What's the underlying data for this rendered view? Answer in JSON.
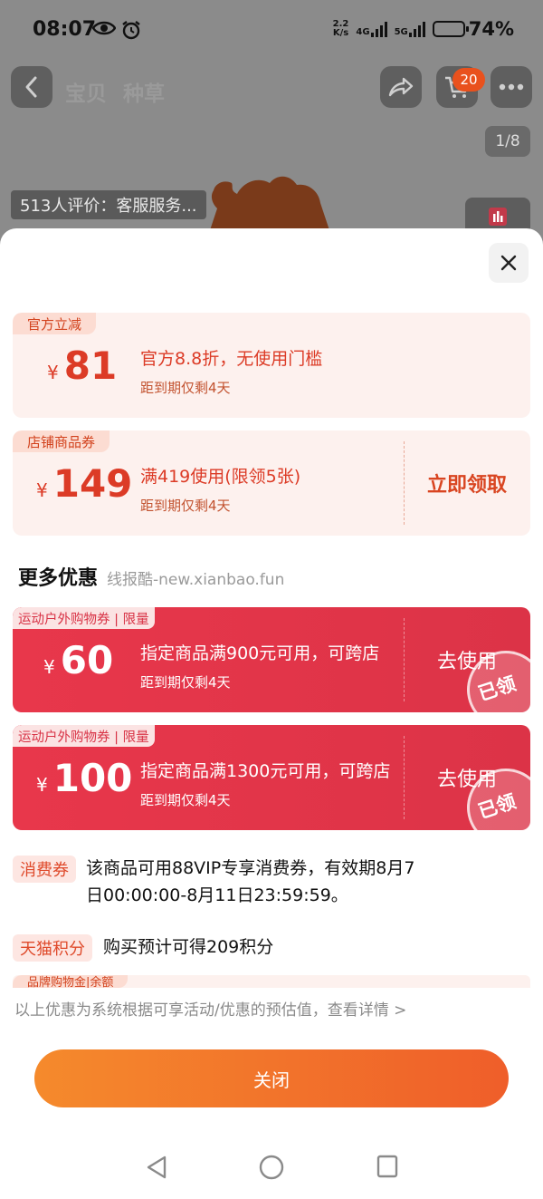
{
  "status_bar": {
    "time": "08:07",
    "net_speed_value": "2.2",
    "net_speed_unit": "K/s",
    "sim1": "4G",
    "sim2": "5G",
    "battery": "74%",
    "battery_level": 0.74
  },
  "product_page": {
    "nav_tabs": [
      "宝贝",
      "种草"
    ],
    "cart_count": "20",
    "image_index": "1/8",
    "review_snippet": "513人评价：客服服务..."
  },
  "coupons_top": [
    {
      "tag": "官方立减",
      "currency": "¥",
      "amount": "81",
      "description": "官方8.8折，无使用门槛",
      "expiry": "距到期仅剩4天",
      "action": ""
    },
    {
      "tag": "店铺商品券",
      "currency": "¥",
      "amount": "149",
      "description": "满419使用(限领5张)",
      "expiry": "距到期仅剩4天",
      "action": "立即领取"
    }
  ],
  "more_section": {
    "title": "更多优惠",
    "watermark": "线报酷-new.xianbao.fun"
  },
  "coupons_more": [
    {
      "tag": "运动户外购物券 | 限量",
      "currency": "¥",
      "amount": "60",
      "description": "指定商品满900元可用，可跨店",
      "expiry": "距到期仅剩4天",
      "action": "去使用",
      "stamp": "已领"
    },
    {
      "tag": "运动户外购物券 | 限量",
      "currency": "¥",
      "amount": "100",
      "description": "指定商品满1300元可用，可跨店",
      "expiry": "距到期仅剩4天",
      "action": "去使用",
      "stamp": "已领"
    }
  ],
  "benefits": [
    {
      "tag": "消费券",
      "line1": "该商品可用88VIP专享消费券，有效期8月7",
      "line2": "日00:00:00-8月11日23:59:59。"
    },
    {
      "tag": "天猫积分",
      "line1": "购买预计可得209积分",
      "line2": ""
    }
  ],
  "partial_row_tag": "品牌购物金|余额",
  "footnote": "以上优惠为系统根据可享活动/优惠的预估值，查看详情 >",
  "close_button": "关闭",
  "colors": {
    "red_coupon": "#e8374b",
    "accent_orange": "#ef5e2a",
    "light_coupon_bg": "#fdf1ee"
  }
}
